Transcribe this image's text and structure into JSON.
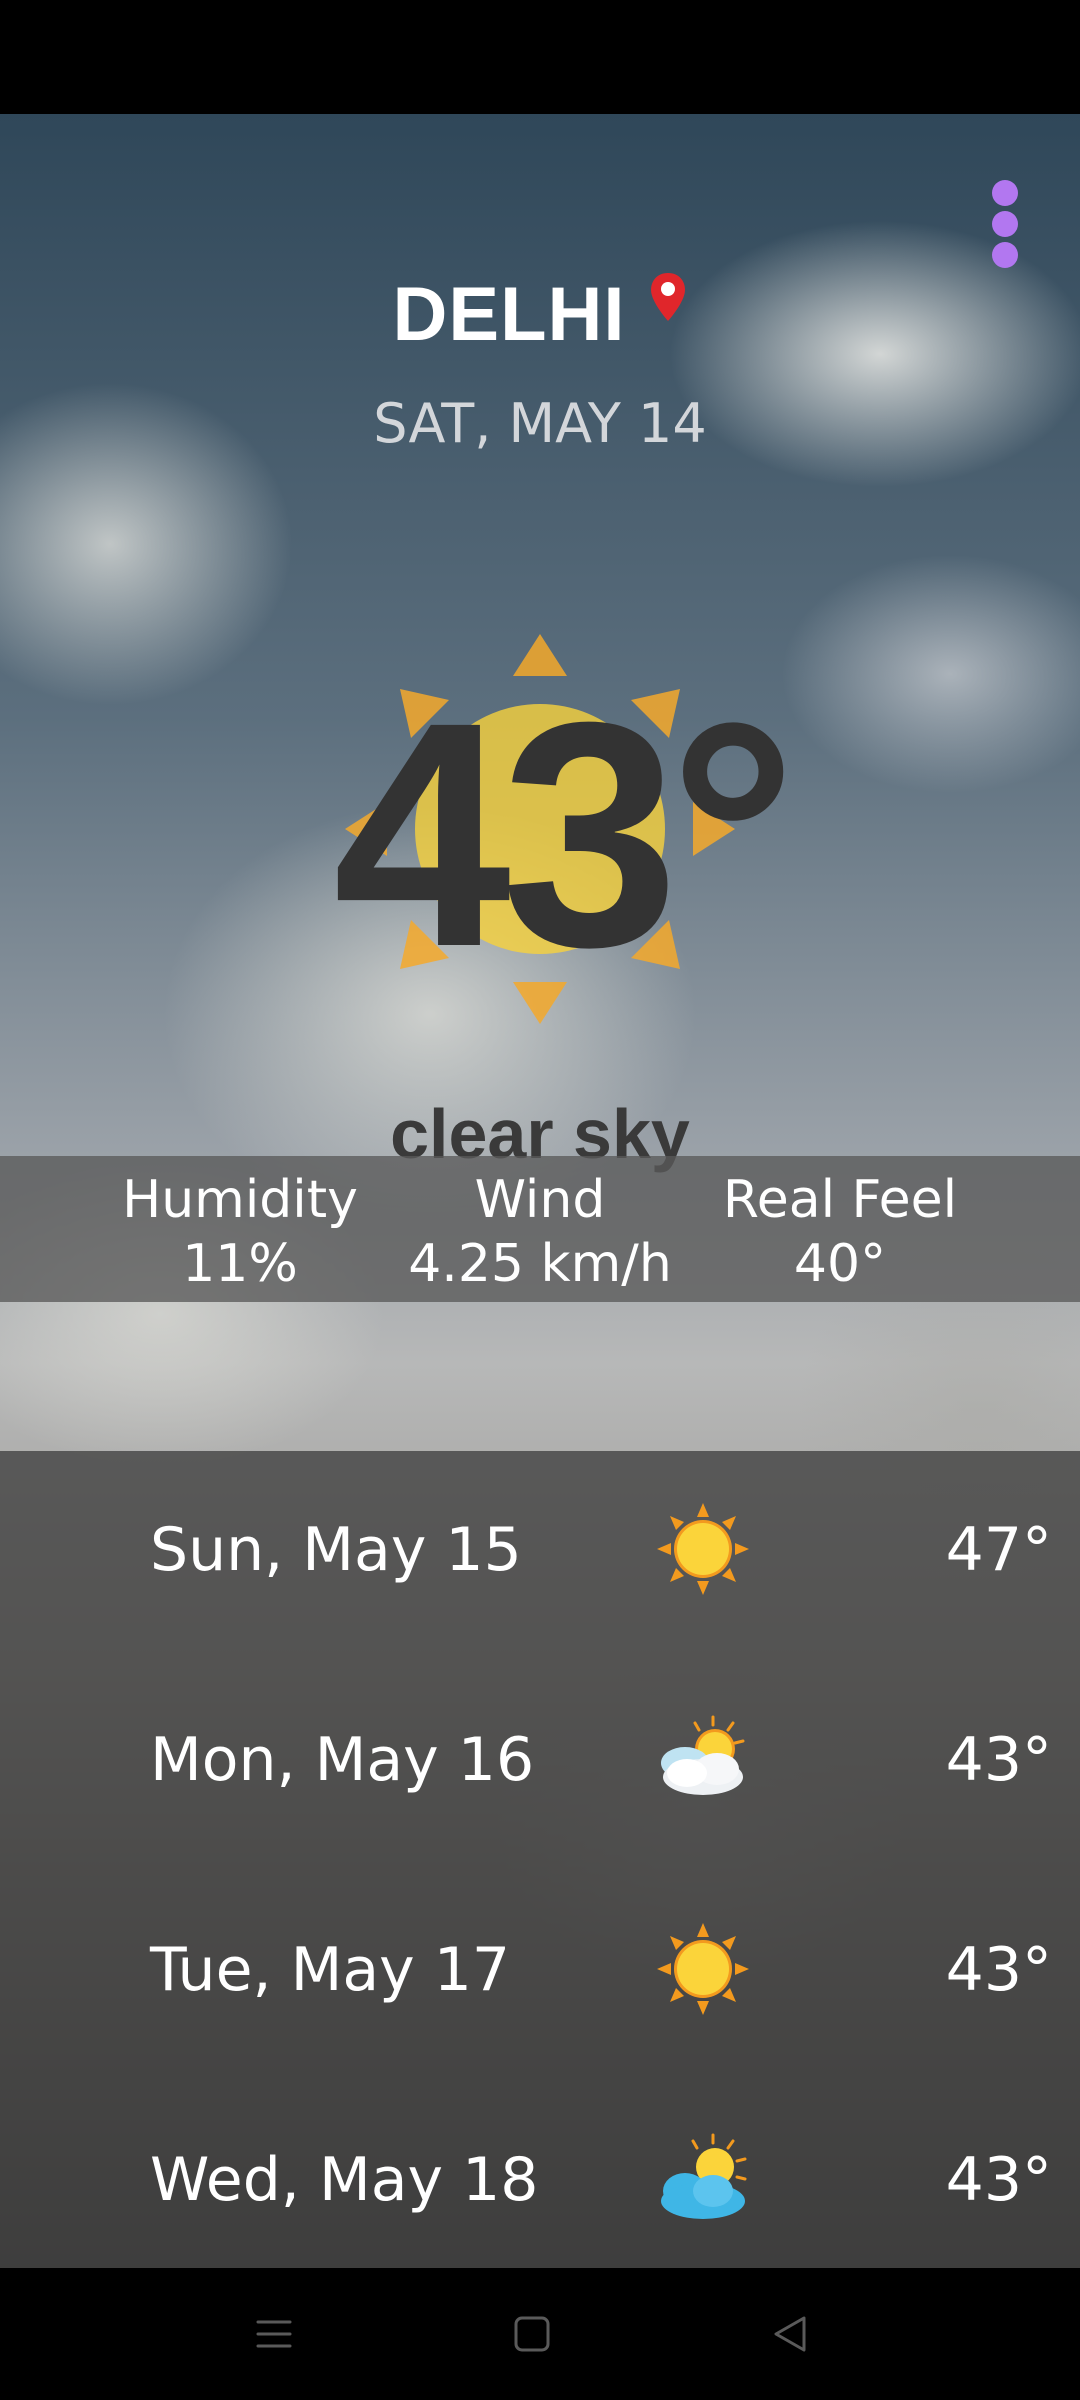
{
  "location": {
    "city": "DELHI"
  },
  "current": {
    "date": "SAT, MAY 14",
    "temperature": "43°",
    "condition": "clear sky",
    "condition_icon": "sun-icon"
  },
  "stats": [
    {
      "label": "Humidity",
      "value": "11%"
    },
    {
      "label": "Wind",
      "value": "4.25 km/h"
    },
    {
      "label": "Real Feel",
      "value": "40°"
    }
  ],
  "forecast": [
    {
      "day": "Sun, May 15",
      "icon": "sunny-icon",
      "temp": "47°"
    },
    {
      "day": "Mon, May 16",
      "icon": "partly-cloudy-icon",
      "temp": "43°"
    },
    {
      "day": "Tue, May 17",
      "icon": "sunny-icon",
      "temp": "43°"
    },
    {
      "day": "Wed, May 18",
      "icon": "sun-behind-cloud-icon",
      "temp": "43°"
    }
  ],
  "colors": {
    "accent_menu": "#b277f0",
    "pin": "#e0262b",
    "temperature_text": "#333333",
    "sun_yellow": "#f7d23c",
    "sun_orange": "#f4a92b"
  },
  "navigation": {
    "buttons": [
      "menu-icon",
      "home-icon",
      "back-icon"
    ]
  }
}
